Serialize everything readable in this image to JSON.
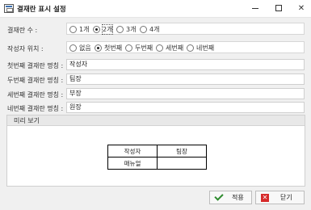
{
  "window": {
    "title": "결재란 표시 설정"
  },
  "count": {
    "label": "결재란 수 :",
    "options": [
      "1개",
      "2개",
      "3개",
      "4개"
    ],
    "selected_index": 1
  },
  "position": {
    "label": "작성자 위치 :",
    "options": [
      "없음",
      "첫번째",
      "두번째",
      "세번째",
      "네번째"
    ],
    "selected_index": 1
  },
  "names": [
    {
      "label": "첫번째 결재란 명칭 :",
      "value": "작성자"
    },
    {
      "label": "두번째 결재란 명칭 :",
      "value": "팀장"
    },
    {
      "label": "세번째 결재란 명칭 :",
      "value": "부장"
    },
    {
      "label": "네번째 결재란 명칭 :",
      "value": "원장"
    }
  ],
  "preview": {
    "title": "미리 보기",
    "header": [
      "작성자",
      "팀장"
    ],
    "row": [
      "매뉴얼",
      ""
    ]
  },
  "buttons": {
    "apply": "적용",
    "close": "닫기"
  },
  "colors": {
    "check": "#2e8b2e",
    "close_icon": "#d62a2a"
  }
}
